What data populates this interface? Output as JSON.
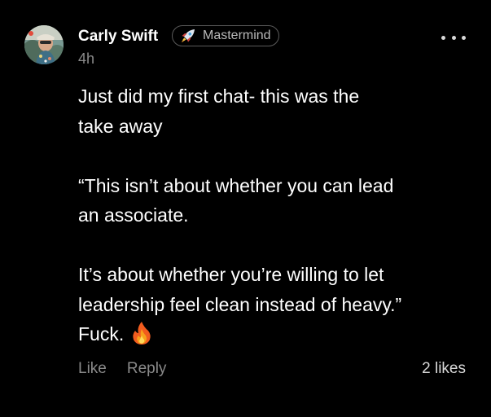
{
  "post": {
    "author": {
      "name": "Carly Swift",
      "avatar_icon": "profile-photo"
    },
    "badge": {
      "icon": "rocket-icon",
      "label": "Mastermind"
    },
    "timestamp": "4h",
    "more_icon": "more-horizontal-icon",
    "body": {
      "line1": "Just did my first chat- this was the",
      "line2": "take away",
      "line3": "“This isn’t about whether you can lead",
      "line4": "an associate.",
      "line5": "It’s about whether you’re willing to let",
      "line6": "leadership feel clean instead of heavy.”",
      "line7": "Fuck.",
      "emoji": "fire-icon"
    },
    "actions": {
      "like_label": "Like",
      "reply_label": "Reply"
    },
    "likes_count": "2 likes"
  },
  "colors": {
    "background": "#000000",
    "text_primary": "#ffffff",
    "text_secondary": "#8a8a8a",
    "badge_border": "#5a5a5a",
    "badge_text": "#b9b9b9"
  }
}
